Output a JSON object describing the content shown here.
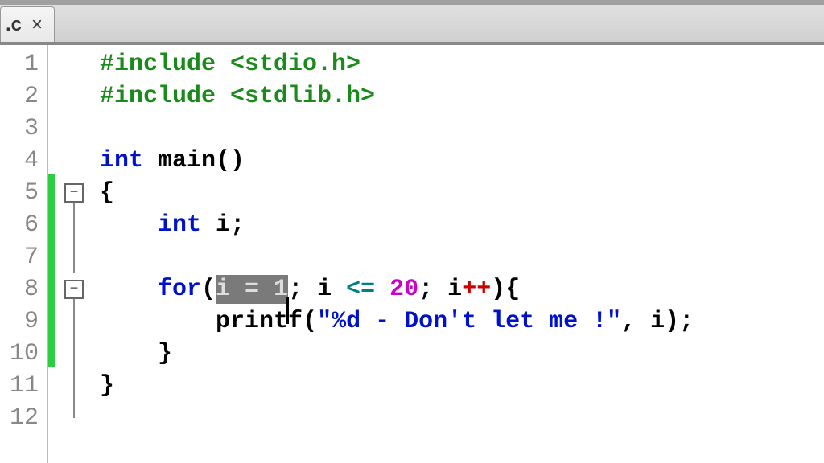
{
  "tab": {
    "name": ".c",
    "close_label": "×"
  },
  "gutter": {
    "lines": [
      "1",
      "2",
      "3",
      "4",
      "5",
      "6",
      "7",
      "8",
      "9",
      "10",
      "11",
      "12"
    ]
  },
  "fold": {
    "minus": "−"
  },
  "code": {
    "l1": {
      "pp": "#include ",
      "hdr": "<stdio.h>"
    },
    "l2": {
      "pp": "#include ",
      "hdr": "<stdlib.h>"
    },
    "l4": {
      "kw1": "int",
      "sp": " ",
      "fn": "main",
      "paren": "()"
    },
    "l5": {
      "brace": "{"
    },
    "l6": {
      "indent": "    ",
      "kw": "int",
      "sp": " ",
      "id": "i",
      "semi": ";"
    },
    "l8": {
      "indent": "    ",
      "kw": "for",
      "op": "(",
      "sel": "i = 1",
      "semi1": "; ",
      "id2": "i",
      "sp2": " ",
      "cmp": "<=",
      "sp3": " ",
      "num": "20",
      "semi2": "; ",
      "id3": "i",
      "inc": "++",
      "close": "){"
    },
    "l9": {
      "indent": "        ",
      "fn": "printf",
      "op": "(",
      "str": "\"%d - Don't let me !\"",
      "comma": ", ",
      "id": "i",
      "close": ");"
    },
    "l10": {
      "indent": "    ",
      "brace": "}"
    },
    "l11": {
      "brace": "}"
    }
  }
}
